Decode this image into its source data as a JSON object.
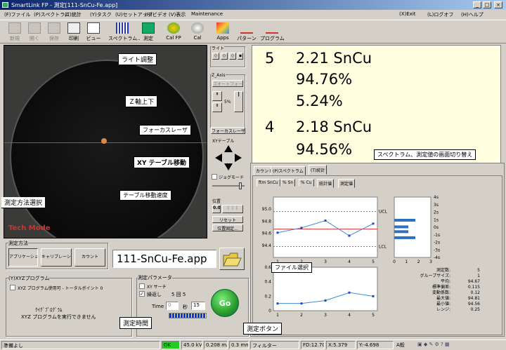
{
  "window": {
    "title": "SmartLink FP - 測定[111-SnCu-Fe.app]"
  },
  "menu": [
    "(F)ファイル",
    "(P)スペクトラム",
    "(T)統計",
    "(Y)タスク",
    "(U)セットアップ",
    "(H)ビデオ",
    "(V)表示",
    "Maintenance",
    "(X)Exit",
    "(L)ログオフ",
    "(H)ヘルプ"
  ],
  "toolbar": [
    "新規",
    "開く",
    "保存",
    "印刷",
    "ビュー",
    "スペクトラム..",
    "測定",
    "Cal FP",
    "Cal",
    "Apps",
    "パターン",
    "プログラム"
  ],
  "camera": {
    "overlay": "Tech Mode",
    "callouts": {
      "light": "ライト調整",
      "z_axis": "Ｚ軸上下",
      "focus": "フォーカスレーザ",
      "xy": "XY テーブル移動",
      "speed": "テーブル移動速度",
      "method": "測定方法選択"
    }
  },
  "controls": {
    "light_label": "ライト",
    "z_label": "Z_Axis",
    "auto_focus": "ズオートフォーカス",
    "z_value": "5%",
    "focus_laser": "フォーカスレーザー",
    "xy_label": "XYテーブル",
    "joy_mode": "ジョグモード",
    "position_label": "位置",
    "pos_value": "0.0",
    "reset": "リセット",
    "position_settings": "位置固定..."
  },
  "results": [
    {
      "idx": "5",
      "v1": "2.21 SnCu",
      "v2": "94.76%",
      "v3": "5.24%"
    },
    {
      "idx": "4",
      "v1": "2.18 SnCu",
      "v2": "94.56%"
    }
  ],
  "chart_panel": {
    "switch_callout": "スペクトラム、測定値の画面切り替え",
    "tabs": [
      "カウント",
      "(P)スペクトラム",
      "(T)統計"
    ],
    "subtabs": [
      "% Sn",
      "% Cu",
      "統計値",
      "測定値"
    ],
    "series_tab": "ftm SnCu",
    "ucl": "UCL",
    "lcl": "LCL",
    "stats_labels": [
      "測定数:",
      "グループサイズ:",
      "平均:",
      "標準偏差:",
      "変動係数:",
      "最大値:",
      "最小値:",
      "レンジ:"
    ],
    "stats_values": [
      "5",
      "1",
      "94.67",
      "0.115",
      "0.12",
      "94.81",
      "94.56",
      "0.25"
    ]
  },
  "chart_data": [
    {
      "type": "line",
      "title": "",
      "x": [
        1,
        2,
        3,
        4,
        5
      ],
      "values": [
        94.61,
        94.69,
        94.81,
        94.56,
        94.76
      ],
      "ylim": [
        94.2,
        95.2
      ],
      "yticks": [
        "95.0",
        "94.8",
        "94.6",
        "94.4"
      ],
      "xticks": [
        "1",
        "2",
        "3",
        "4",
        "5"
      ],
      "ucl": 94.96,
      "lcl": 94.38,
      "mean": 94.67
    },
    {
      "type": "line",
      "title": "",
      "x": [
        1,
        2,
        3,
        4,
        5
      ],
      "values": [
        0.1,
        0.1,
        0.14,
        0.25,
        0.2
      ],
      "ylim": [
        0,
        0.6
      ],
      "yticks": [
        "0.6",
        "0.4",
        "0.2",
        "0"
      ],
      "xticks": [
        "1",
        "2",
        "3",
        "4",
        "5"
      ]
    }
  ],
  "sigma_labels": [
    "4s",
    "3s",
    "2s",
    "1s",
    "0s",
    "-1s",
    "-2s",
    "-3s",
    "-4s"
  ],
  "hist_xticks": [
    "0",
    "1",
    "2",
    "3"
  ],
  "method": {
    "label": "測定方法",
    "buttons": [
      "アプリケーション",
      "キャリブレーション",
      "カウント"
    ],
    "app_name": "111-SnCu-Fe.app",
    "file_callout": "ファイル選択"
  },
  "xyz": {
    "label": "(Y)XYZプログラム",
    "use_check": "XYZ プログラム使用可 - トータルポイント 0",
    "no_program": "ｸｲｸﾞﾌﾟﾛｸﾞﾗﾑ",
    "cannot_run": "XYZ プログラムを実行できません"
  },
  "params": {
    "label": "測定パラメータ",
    "xy_search": "XY サーチ",
    "repeat": "繰返し",
    "repeat_val": "5 回 5",
    "time_label": "Time",
    "time_val": "0",
    "time_to": "秒",
    "time_total": "15",
    "go": "Go",
    "time_callout": "測定時間",
    "go_callout": "測定ボタン"
  },
  "status": {
    "ready": "準備よし",
    "ok": "OK",
    "kv": "45.0 kV",
    "ma": "0.208 mA",
    "mm": "0.3 mm",
    "filter": "フィルター",
    "fd": "FD:12.70",
    "x": "X:5.379",
    "y": "Y:-4.698",
    "lang": "A般"
  },
  "colors": {
    "accent": "#0a246a",
    "result_bg": "#ffffe0",
    "go": "#2a9a2a",
    "ucl": "#3a3"
  }
}
